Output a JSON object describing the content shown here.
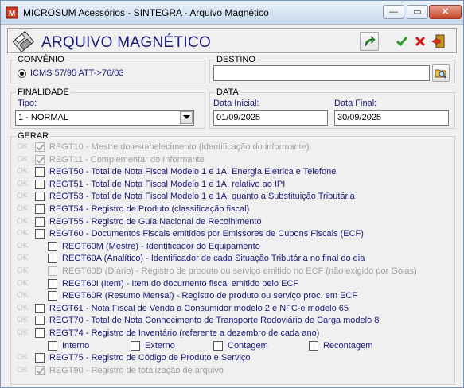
{
  "window": {
    "title": "MICROSUM Acessórios - SINTEGRA - Arquivo Magnético",
    "minimize": "—",
    "maximize": "▭",
    "close": "✕"
  },
  "header": {
    "title": "ARQUIVO MAGNÉTICO"
  },
  "convenio": {
    "label": "CONVÊNIO",
    "option": "ICMS 57/95 ATT->76/03"
  },
  "destino": {
    "label": "DESTINO",
    "value": ""
  },
  "finalidade": {
    "label": "FINALIDADE",
    "tipo_label": "Tipo:",
    "tipo_value": "1 - NORMAL"
  },
  "data": {
    "label": "DATA",
    "inicial_label": "Data Inicial:",
    "inicial_value": "01/09/2025",
    "final_label": "Data Final:",
    "final_value": "30/09/2025"
  },
  "gerar": {
    "label": "GERAR",
    "ok_text": "OK",
    "rows": [
      {
        "text": "REGT10 - Mestre do estabelecimento (identificação do informante)",
        "checked": true,
        "disabled": true,
        "indent": 0
      },
      {
        "text": "REGT11 - Complementar do Informante",
        "checked": true,
        "disabled": true,
        "indent": 0
      },
      {
        "text": "REGT50 - Total de Nota Fiscal Modelo 1 e 1A, Energia Elétrica e Telefone",
        "checked": false,
        "disabled": false,
        "indent": 0
      },
      {
        "text": "REGT51 - Total de Nota Fiscal Modelo 1 e 1A, relativo ao IPI",
        "checked": false,
        "disabled": false,
        "indent": 0
      },
      {
        "text": "REGT53 - Total de Nota Fiscal Modelo 1 e 1A, quanto a Substituição Tributária",
        "checked": false,
        "disabled": false,
        "indent": 0
      },
      {
        "text": "REGT54 - Registro de Produto (classificação fiscal)",
        "checked": false,
        "disabled": false,
        "indent": 0
      },
      {
        "text": "REGT55 - Registro de Guia Nacional de Recolhimento",
        "checked": false,
        "disabled": false,
        "indent": 0
      },
      {
        "text": "REGT60 - Documentos Fiscais emitidos por Emissores de Cupons Fiscais (ECF)",
        "checked": false,
        "disabled": false,
        "indent": 0
      },
      {
        "text": "REGT60M (Mestre) - Identificador do Equipamento",
        "checked": false,
        "disabled": false,
        "indent": 1
      },
      {
        "text": "REGT60A (Analítico) - Identificador de cada Situação Tributária no final do dia",
        "checked": false,
        "disabled": false,
        "indent": 1
      },
      {
        "text": "REGT60D (Diário) - Registro de produto ou serviço emitido no ECF (não exigido por Goiás)",
        "checked": false,
        "disabled": true,
        "indent": 1
      },
      {
        "text": "REGT60I (Item) - Item do documento fiscal emitido pelo ECF",
        "checked": false,
        "disabled": false,
        "indent": 1
      },
      {
        "text": "REGT60R (Resumo Mensal) - Registro de produto ou serviço proc. em ECF",
        "checked": false,
        "disabled": false,
        "indent": 1
      },
      {
        "text": "REGT61 - Nota Fiscal de Venda a Consumidor modelo 2 e NFC-e modelo 65",
        "checked": false,
        "disabled": false,
        "indent": 0
      },
      {
        "text": "REGT70 - Total de Nota Conhecimento de Transporte Rodoviário de Carga modelo 8",
        "checked": false,
        "disabled": false,
        "indent": 0
      },
      {
        "text": "REGT74 - Registro de Inventário (referente a dezembro de cada ano)",
        "checked": false,
        "disabled": false,
        "indent": 0
      }
    ],
    "inventario_options": [
      "Interno",
      "Externo",
      "Contagem",
      "Recontagem"
    ],
    "tail_rows": [
      {
        "text": "REGT75 - Registro de Código de Produto e Serviço",
        "checked": false,
        "disabled": false,
        "indent": 0
      },
      {
        "text": "REGT90 - Registro de totalização de arquivo",
        "checked": true,
        "disabled": true,
        "indent": 0
      }
    ]
  },
  "colors": {
    "accent_text": "#1a1a7a",
    "disabled_text": "#a0a0a0",
    "confirm_green": "#2e9a2e",
    "cancel_red": "#d01818"
  }
}
